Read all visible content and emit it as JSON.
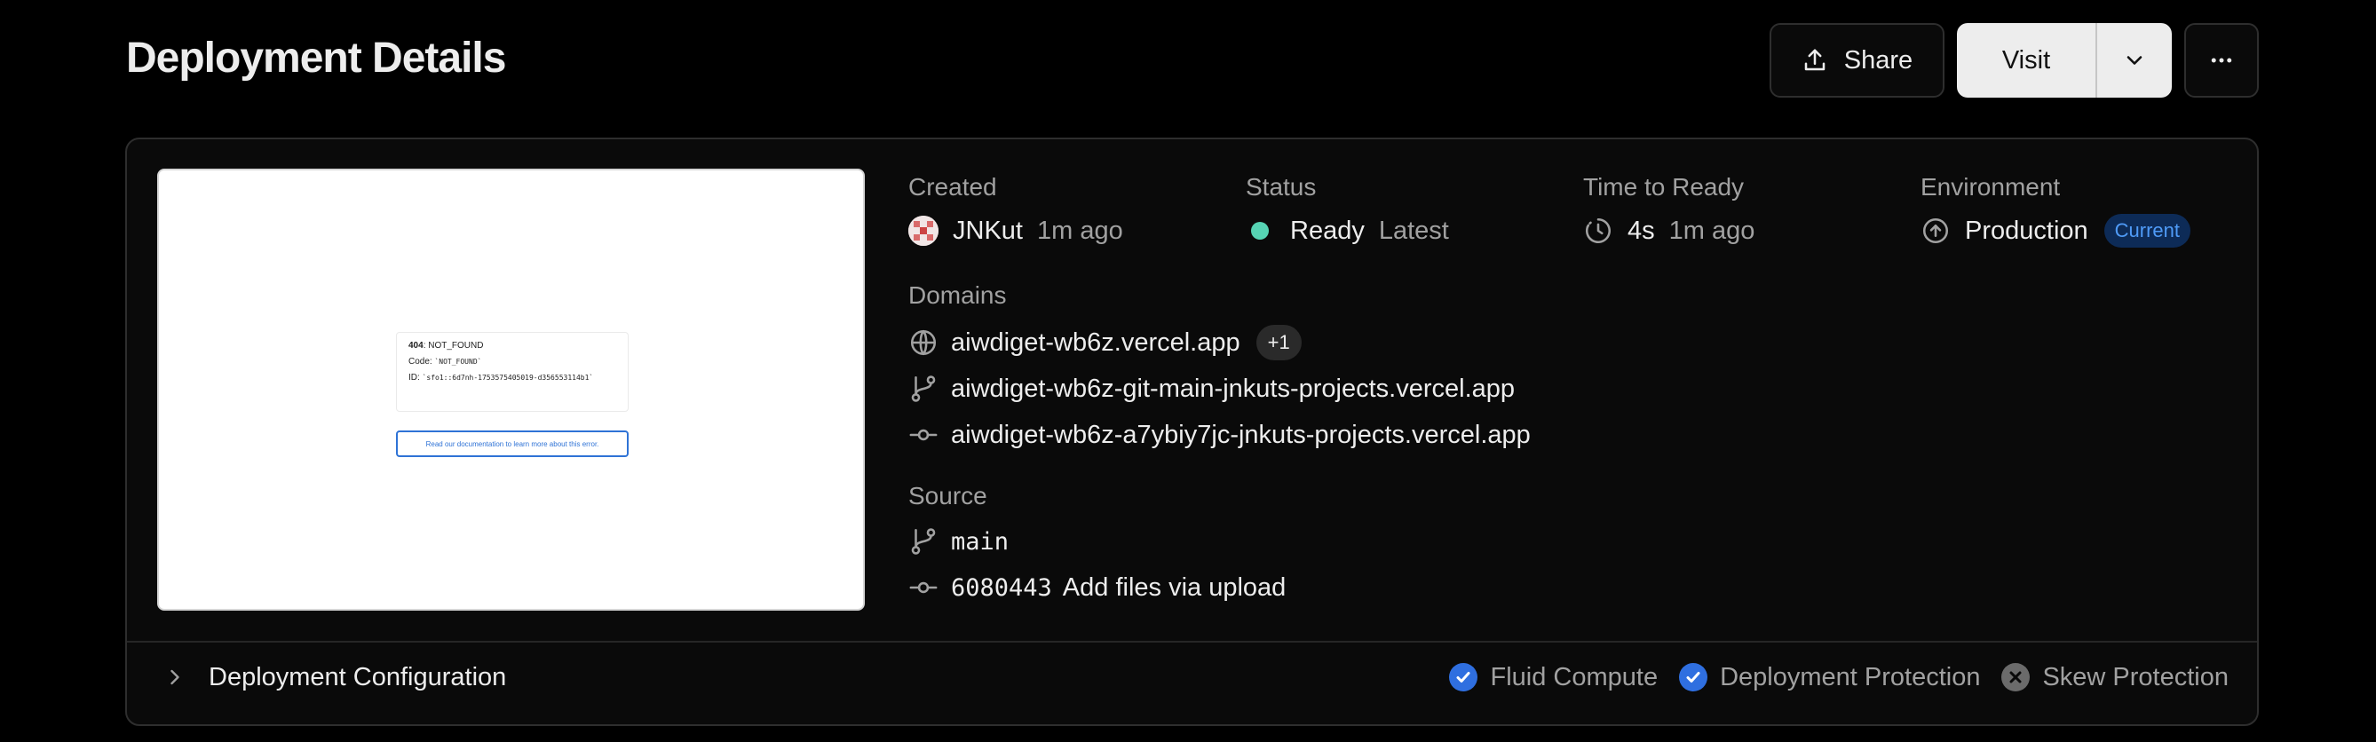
{
  "header": {
    "title": "Deployment Details",
    "share_label": "Share",
    "visit_label": "Visit"
  },
  "preview": {
    "code_bold": "404",
    "code_rest": ": NOT_FOUND",
    "code_label": "Code: ",
    "code_value": "`NOT_FOUND`",
    "id_label": "ID: ",
    "id_value": "`sfo1::6d7nh-1753575405019-d356553114b1`",
    "link_text": "Read our documentation to learn more about this error."
  },
  "created": {
    "label": "Created",
    "user": "JNKut",
    "time": "1m ago"
  },
  "status": {
    "label": "Status",
    "value": "Ready",
    "tag": "Latest",
    "color": "#56d3b3"
  },
  "time_to_ready": {
    "label": "Time to Ready",
    "value": "4s",
    "time": "1m ago"
  },
  "environment": {
    "label": "Environment",
    "value": "Production",
    "badge": "Current"
  },
  "domains": {
    "label": "Domains",
    "items": [
      {
        "icon": "globe-icon",
        "text": "aiwdiget-wb6z.vercel.app",
        "badge": "+1"
      },
      {
        "icon": "git-branch-icon",
        "text": "aiwdiget-wb6z-git-main-jnkuts-projects.vercel.app"
      },
      {
        "icon": "git-commit-icon",
        "text": "aiwdiget-wb6z-a7ybiy7jc-jnkuts-projects.vercel.app"
      }
    ]
  },
  "source": {
    "label": "Source",
    "branch": "main",
    "commit_hash": "6080443",
    "commit_message": "Add files via upload"
  },
  "footer": {
    "config_label": "Deployment Configuration",
    "features": [
      {
        "label": "Fluid Compute",
        "enabled": true
      },
      {
        "label": "Deployment Protection",
        "enabled": true
      },
      {
        "label": "Skew Protection",
        "enabled": false
      }
    ]
  },
  "colors": {
    "accent_blue": "#2f6fe0",
    "ready_green": "#56d3b3"
  }
}
